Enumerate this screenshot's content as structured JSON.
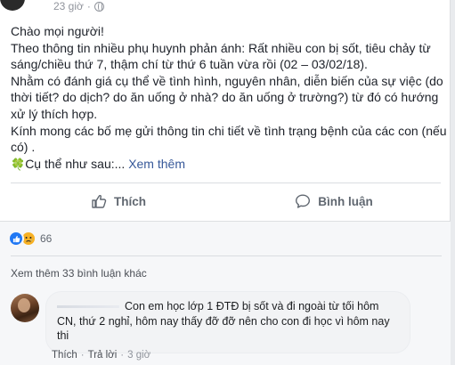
{
  "post": {
    "time": "23 giờ",
    "paragraphs": [
      "Chào mọi người!",
      "Theo thông tin nhiều phụ huynh phản ánh: Rất nhiều con bị sốt, tiêu chảy từ sáng/chiều thứ 7, thậm chí từ thứ 6 tuần vừa rồi (02 – 03/02/18).",
      "Nhằm có đánh giá cụ thể về tình hình, nguyên nhân, diễn biến của sự việc (do thời tiết? do dịch? do ăn uống ở nhà? do ăn uống ở trường?) từ đó có hướng xử lý thích hợp.",
      "Kính mong các bố mẹ gửi thông tin chi tiết về tình trạng bệnh của các con (nếu có) ."
    ],
    "last_line": "Cụ thể như sau:...",
    "see_more": "Xem thêm",
    "clover_glyph": "🍀"
  },
  "actions": {
    "like_label": "Thích",
    "comment_label": "Bình luận"
  },
  "reactions": {
    "count": "66",
    "types": [
      "like",
      "sad"
    ],
    "like_color": "#2078f4",
    "sad_color": "#f7b125"
  },
  "comments": {
    "view_more": "Xem thêm 33 bình luận khác",
    "items": [
      {
        "text": "Con em học lớp 1 ĐTĐ bị sốt và đi ngoài từ tối hôm CN, thứ 2 nghỉ, hôm nay thấy đỡ đỡ nên cho con đi học vì hôm nay thi",
        "like_label": "Thích",
        "reply_label": "Trả lời",
        "separator": "·",
        "time": "3 giờ"
      }
    ]
  },
  "colors": {
    "link": "#365899",
    "muted": "#90949c",
    "action_text": "#606770",
    "comments_bg": "#f6f7f9"
  }
}
